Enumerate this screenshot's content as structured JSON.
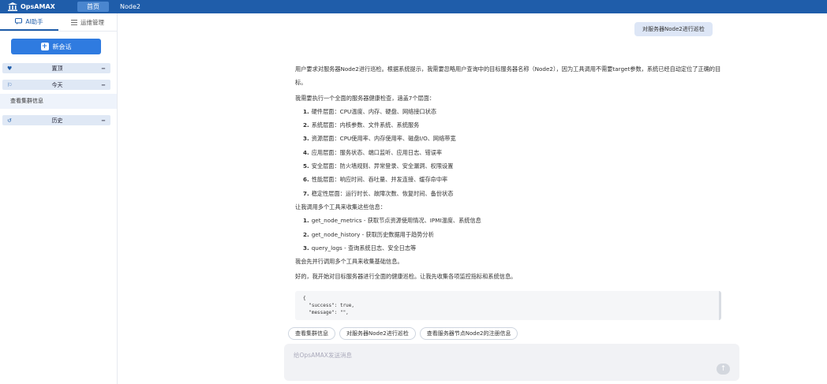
{
  "app": {
    "title": "OpsAMAX",
    "logo_icon": "building-icon"
  },
  "nav": {
    "tabs": [
      {
        "label": "首页",
        "active": true
      },
      {
        "label": "Node2",
        "active": false
      }
    ]
  },
  "sidebar": {
    "tabs": [
      {
        "label": "AI助手",
        "icon": "chat-icon",
        "active": true
      },
      {
        "label": "运维管理",
        "icon": "menu-icon",
        "active": false
      }
    ],
    "new_chat_label": "新会话",
    "groups": [
      {
        "label": "置顶",
        "icon": "heart-icon",
        "toggle": "−"
      },
      {
        "label": "今天",
        "icon": "flag-icon",
        "toggle": "−"
      },
      {
        "label": "历史",
        "icon": "history-icon",
        "toggle": "−"
      }
    ],
    "today_items": [
      "查看集群信息"
    ]
  },
  "chat": {
    "user_message": "对服务器Node2进行巡检",
    "reply": {
      "intro": "用户要求对服务器Node2进行巡检。根据系统提示，我需要忽略用户查询中的目标服务器名称（Node2），因为工具调用不需要target参数，系统已经自动定位了正确的目标。",
      "plan_intro": "我需要执行一个全面的服务器健康检查，涵盖7个层面：",
      "plan_items": [
        {
          "num": "1.",
          "text": "硬件层面：CPU温度、内存、硬盘、网络接口状态"
        },
        {
          "num": "2.",
          "text": "系统层面：内核参数、文件系统、系统服务"
        },
        {
          "num": "3.",
          "text": "资源层面：CPU使用率、内存使用率、磁盘I/O、网络带宽"
        },
        {
          "num": "4.",
          "text": "应用层面：服务状态、端口监听、应用日志、错误率"
        },
        {
          "num": "5.",
          "text": "安全层面：防火墙规则、异常登录、安全漏洞、权限设置"
        },
        {
          "num": "6.",
          "text": "性能层面：响应时间、吞吐量、并发连接、缓存命中率"
        },
        {
          "num": "7.",
          "text": "稳定性层面：运行时长、故障次数、恢复时间、备份状态"
        }
      ],
      "tools_intro": "让我调用多个工具来收集这些信息：",
      "tools": [
        {
          "num": "1.",
          "text": "get_node_metrics - 获取节点资源使用情况、IPMI温度、系统信息"
        },
        {
          "num": "2.",
          "text": "get_node_history - 获取历史数据用于趋势分析"
        },
        {
          "num": "3.",
          "text": "query_logs - 查询系统日志、安全日志等"
        }
      ],
      "parallel": "我会先并行调用多个工具来收集基础信息。",
      "start": "好的，我开始对目标服务器进行全面的健康巡检。让我先收集各项监控指标和系统信息。",
      "code_lines": [
        "{",
        "  \"success\": true,",
        "  \"message\": \"\","
      ]
    },
    "suggestions": [
      "查看集群信息",
      "对服务器Node2进行巡检",
      "查看服务器节点Node2的注册信息"
    ],
    "input_placeholder": "给OpsAMAX发送消息",
    "send_icon": "arrow-up-icon"
  }
}
